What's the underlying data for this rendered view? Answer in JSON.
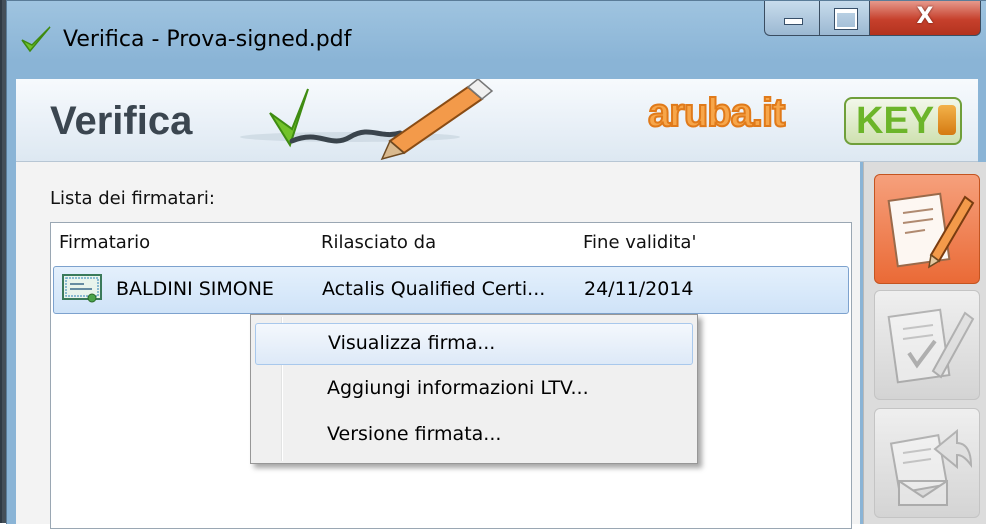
{
  "window": {
    "title": "Verifica - Prova-signed.pdf",
    "close_glyph": "X"
  },
  "header": {
    "title": "Verifica",
    "brand": "aruba.it",
    "brand_badge": "KEY"
  },
  "signers": {
    "label": "Lista dei firmatari:",
    "columns": [
      "Firmatario",
      "Rilasciato da",
      "Fine validita'"
    ],
    "rows": [
      {
        "name": "BALDINI SIMONE",
        "issuer": "Actalis Qualified Certi...",
        "expiry": "24/11/2014",
        "icon": "certificate-icon"
      }
    ]
  },
  "context_menu": {
    "items": [
      "Visualizza firma...",
      "Aggiungi informazioni LTV...",
      "Versione firmata..."
    ],
    "hover_index": 0
  },
  "toolbar": {
    "buttons": [
      {
        "icon": "verify-document-pen-icon",
        "state": "active"
      },
      {
        "icon": "signed-document-icon",
        "state": "inactive"
      },
      {
        "icon": "export-envelope-icon",
        "state": "inactive"
      }
    ]
  },
  "colors": {
    "accent_orange": "#ea6a36",
    "brand_orange": "#f7a64a",
    "key_green": "#6cb52a",
    "selection": "#cfe3f8",
    "close_red": "#c6402c"
  }
}
